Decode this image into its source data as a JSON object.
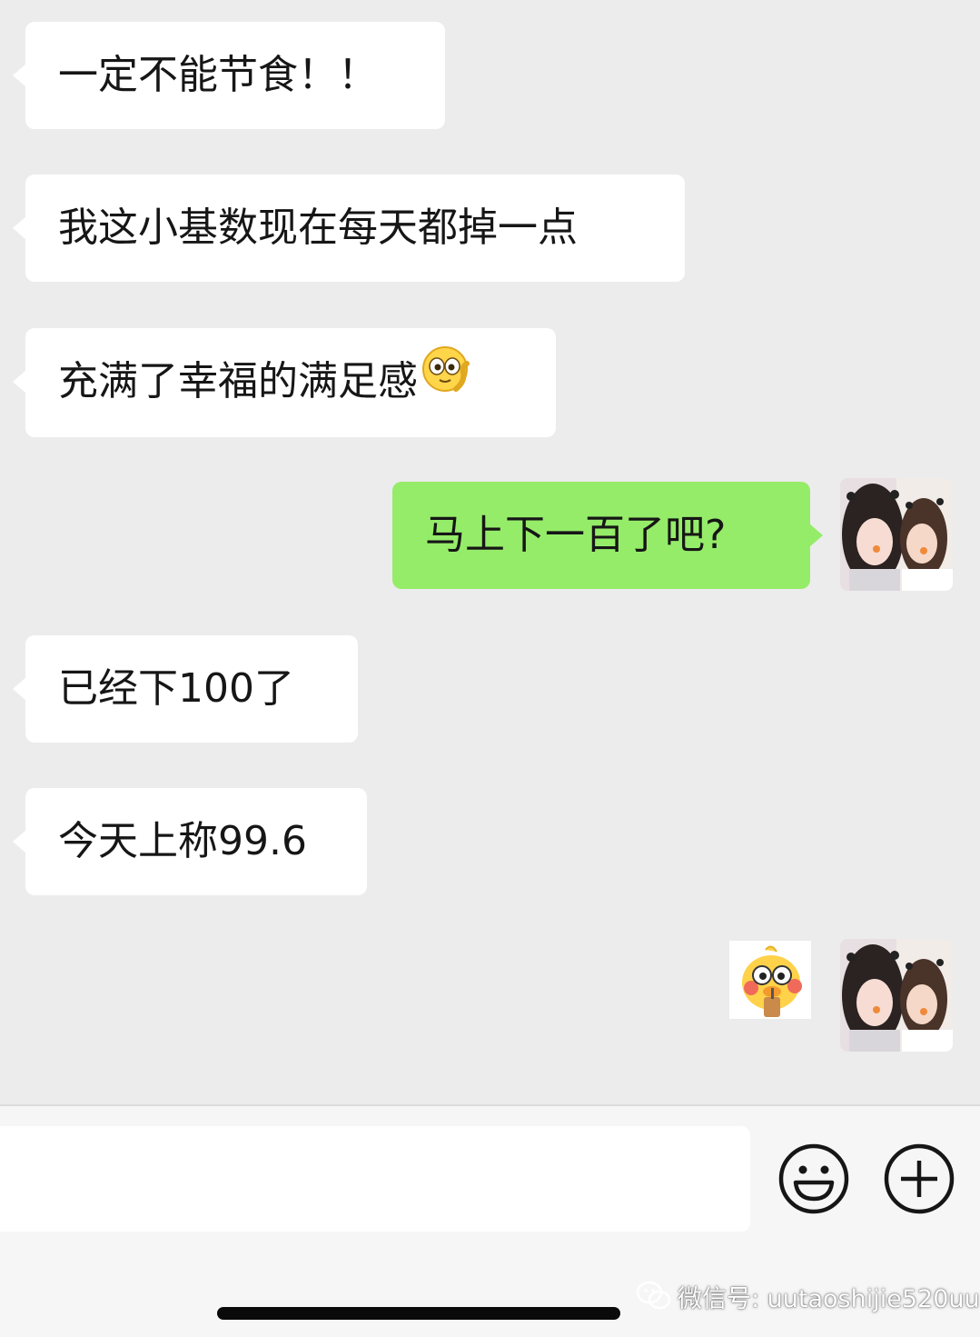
{
  "messages": [
    {
      "sender": "other",
      "text": "一定不能节食！！"
    },
    {
      "sender": "other",
      "text": "我这小基数现在每天都掉一点"
    },
    {
      "sender": "other",
      "text": "充满了幸福的满足感",
      "emoji": "smirk-chin-emoji"
    },
    {
      "sender": "me",
      "text": "马上下一百了吧?"
    },
    {
      "sender": "other",
      "text": "已经下100了"
    },
    {
      "sender": "other",
      "text": "今天上称99.6"
    },
    {
      "sender": "me",
      "type": "sticker",
      "sticker": "yellow-duck-drinking-sticker"
    }
  ],
  "composer": {
    "input_value": "",
    "emoji_icon": "smiley-face-icon",
    "plus_icon": "plus-circle-icon"
  },
  "watermark": {
    "icon": "wechat-logo-icon",
    "text": "微信号: uutaoshijie520uu"
  },
  "colors": {
    "background": "#ececec",
    "incoming_bubble": "#ffffff",
    "outgoing_bubble": "#95ec69"
  }
}
